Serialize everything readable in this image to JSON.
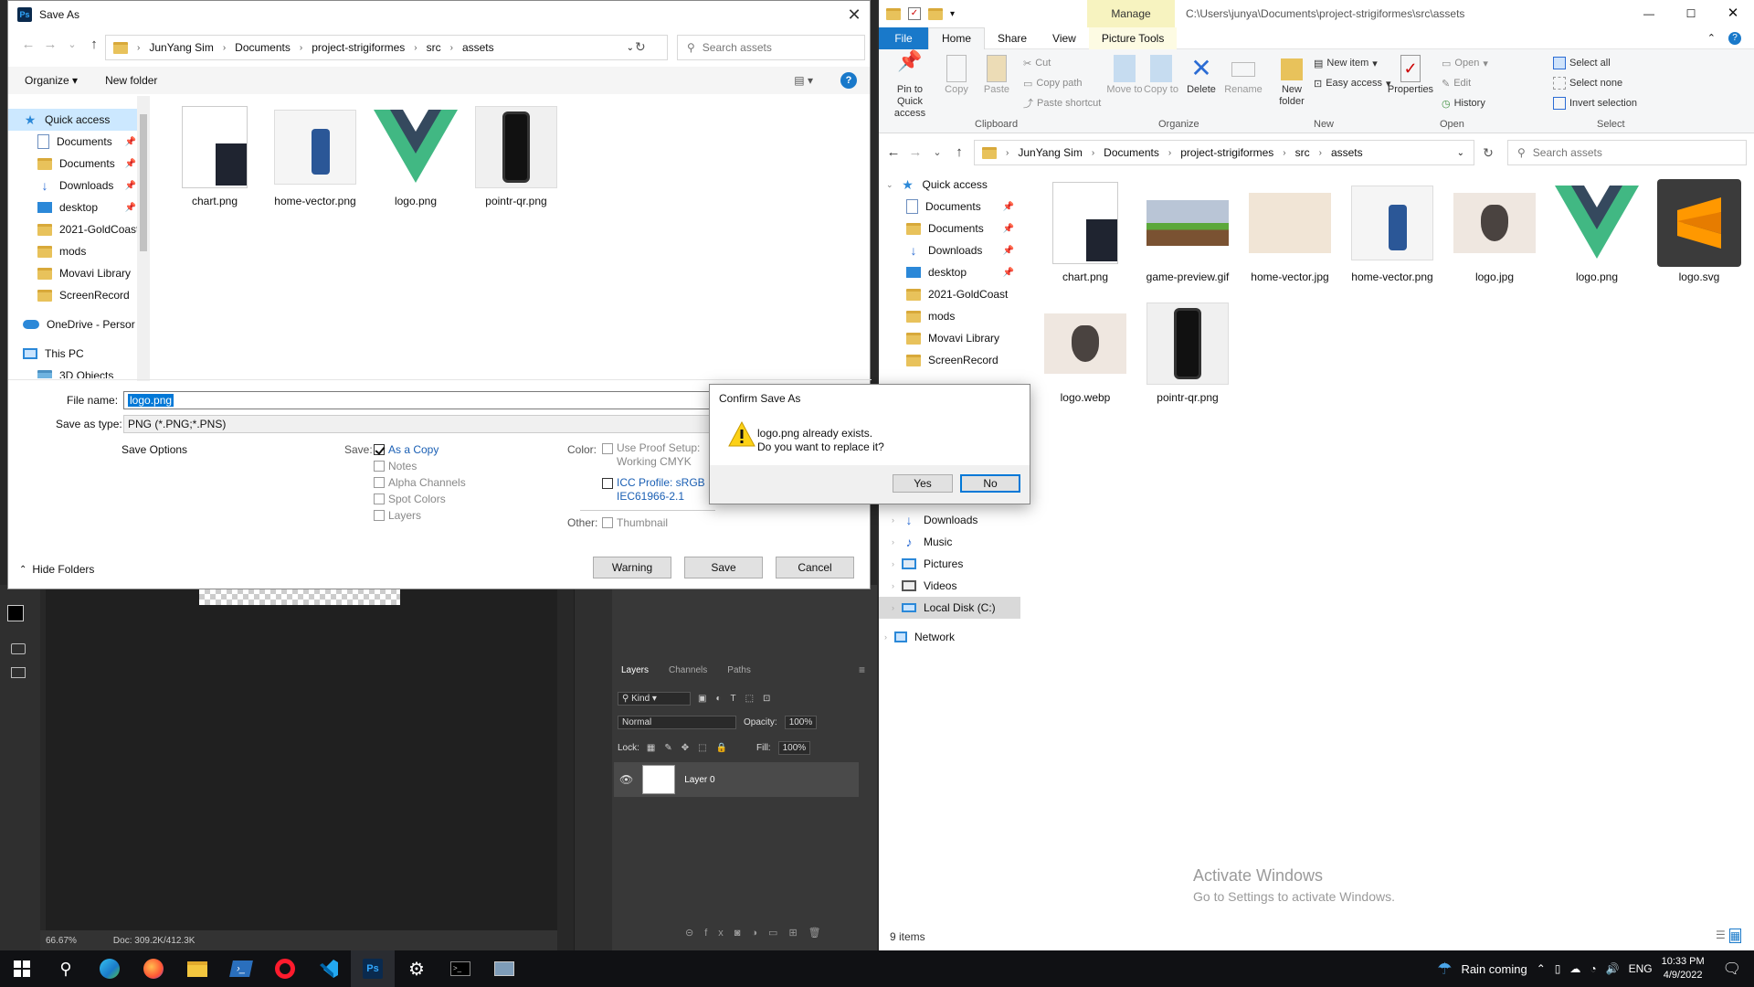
{
  "saveas": {
    "title": "Save As",
    "breadcrumb": [
      "JunYang Sim",
      "Documents",
      "project-strigiformes",
      "src",
      "assets"
    ],
    "search_placeholder": "Search assets",
    "organize": "Organize",
    "new_folder": "New folder",
    "nav": [
      {
        "label": "Quick access",
        "icon": "star-icon"
      },
      {
        "label": "Documents",
        "icon": "documents-icon",
        "pinned": true
      },
      {
        "label": "Documents",
        "icon": "folder-icon",
        "pinned": true
      },
      {
        "label": "Downloads",
        "icon": "downloads-icon",
        "pinned": true
      },
      {
        "label": "desktop",
        "icon": "desktop-icon",
        "pinned": true
      },
      {
        "label": "2021-GoldCoast",
        "icon": "folder-icon"
      },
      {
        "label": "mods",
        "icon": "folder-icon"
      },
      {
        "label": "Movavi Library",
        "icon": "folder-icon"
      },
      {
        "label": "ScreenRecord",
        "icon": "folder-icon"
      },
      {
        "label": "OneDrive - Persor",
        "icon": "onedrive-icon"
      },
      {
        "label": "This PC",
        "icon": "this-pc-icon"
      },
      {
        "label": "3D Objects",
        "icon": "3d-objects-icon"
      }
    ],
    "files": [
      "chart.png",
      "home-vector.png",
      "logo.png",
      "pointr-qr.png"
    ],
    "file_name_label": "File name:",
    "file_name_value": "logo.png",
    "save_as_type_label": "Save as type:",
    "save_as_type_value": "PNG (*.PNG;*.PNS)",
    "save_options": "Save Options",
    "save_label": "Save:",
    "opt_as_copy": "As a Copy",
    "opt_notes": "Notes",
    "opt_alpha": "Alpha Channels",
    "opt_spot": "Spot Colors",
    "opt_layers": "Layers",
    "color_label": "Color:",
    "opt_proof_1": "Use Proof Setup:",
    "opt_proof_2": "Working CMYK",
    "opt_icc_1": "ICC Profile:  sRGB",
    "opt_icc_2": "IEC61966-2.1",
    "other_label": "Other:",
    "opt_thumbnail": "Thumbnail",
    "hide_folders": "Hide Folders",
    "btn_warning": "Warning",
    "btn_save": "Save",
    "btn_cancel": "Cancel"
  },
  "confirm": {
    "title": "Confirm Save As",
    "line1": "logo.png already exists.",
    "line2": "Do you want to replace it?",
    "yes": "Yes",
    "no": "No"
  },
  "photoshop": {
    "zoom": "66.67%",
    "doc": "Doc: 309.2K/412.3K",
    "tabs": [
      "Layers",
      "Channels",
      "Paths"
    ],
    "kind": "Kind",
    "blend_mode": "Normal",
    "opacity_label": "Opacity:",
    "opacity_value": "100%",
    "lock_label": "Lock:",
    "fill_label": "Fill:",
    "fill_value": "100%",
    "layer_name": "Layer 0"
  },
  "explorer": {
    "manage_tab": "Manage",
    "path": "C:\\Users\\junya\\Documents\\project-strigiformes\\src\\assets",
    "tabs": [
      "File",
      "Home",
      "Share",
      "View",
      "Picture Tools"
    ],
    "ribbon": {
      "pin": "Pin to Quick access",
      "copy": "Copy",
      "paste": "Paste",
      "cut": "Cut",
      "copy_path": "Copy path",
      "paste_shortcut": "Paste shortcut",
      "clipboard": "Clipboard",
      "move_to": "Move to",
      "copy_to": "Copy to",
      "delete": "Delete",
      "rename": "Rename",
      "organize": "Organize",
      "new_folder": "New folder",
      "new_item": "New item",
      "easy_access": "Easy access",
      "new": "New",
      "properties": "Properties",
      "open": "Open",
      "edit": "Edit",
      "history": "History",
      "open_grp": "Open",
      "select_all": "Select all",
      "select_none": "Select none",
      "invert_selection": "Invert selection",
      "select_grp": "Select"
    },
    "breadcrumb": [
      "JunYang Sim",
      "Documents",
      "project-strigiformes",
      "src",
      "assets"
    ],
    "search_placeholder": "Search assets",
    "nav": [
      {
        "label": "Quick access",
        "icon": "star-icon"
      },
      {
        "label": "Documents",
        "icon": "documents-icon",
        "pinned": true
      },
      {
        "label": "Documents",
        "icon": "folder-icon",
        "pinned": true
      },
      {
        "label": "Downloads",
        "icon": "downloads-icon",
        "pinned": true
      },
      {
        "label": "desktop",
        "icon": "desktop-icon",
        "pinned": true
      },
      {
        "label": "2021-GoldCoast",
        "icon": "folder-icon"
      },
      {
        "label": "mods",
        "icon": "folder-icon"
      },
      {
        "label": "Movavi Library",
        "icon": "folder-icon"
      },
      {
        "label": "ScreenRecord",
        "icon": "folder-icon"
      }
    ],
    "nav_lower": [
      {
        "label": "Downloads",
        "icon": "downloads-icon"
      },
      {
        "label": "Music",
        "icon": "music-icon"
      },
      {
        "label": "Pictures",
        "icon": "pictures-icon"
      },
      {
        "label": "Videos",
        "icon": "videos-icon"
      },
      {
        "label": "Local Disk (C:)",
        "icon": "disk-icon"
      },
      {
        "label": "Network",
        "icon": "network-icon"
      }
    ],
    "files": [
      "chart.png",
      "game-preview.gif",
      "home-vector.jpg",
      "home-vector.png",
      "logo.jpg",
      "logo.png",
      "logo.svg",
      "logo.webp",
      "pointr-qr.png"
    ],
    "status": "9 items",
    "watermark_title": "Activate Windows",
    "watermark_sub": "Go to Settings to activate Windows."
  },
  "taskbar": {
    "weather": "Rain coming",
    "lang": "ENG",
    "time": "10:33 PM",
    "date": "4/9/2022"
  }
}
